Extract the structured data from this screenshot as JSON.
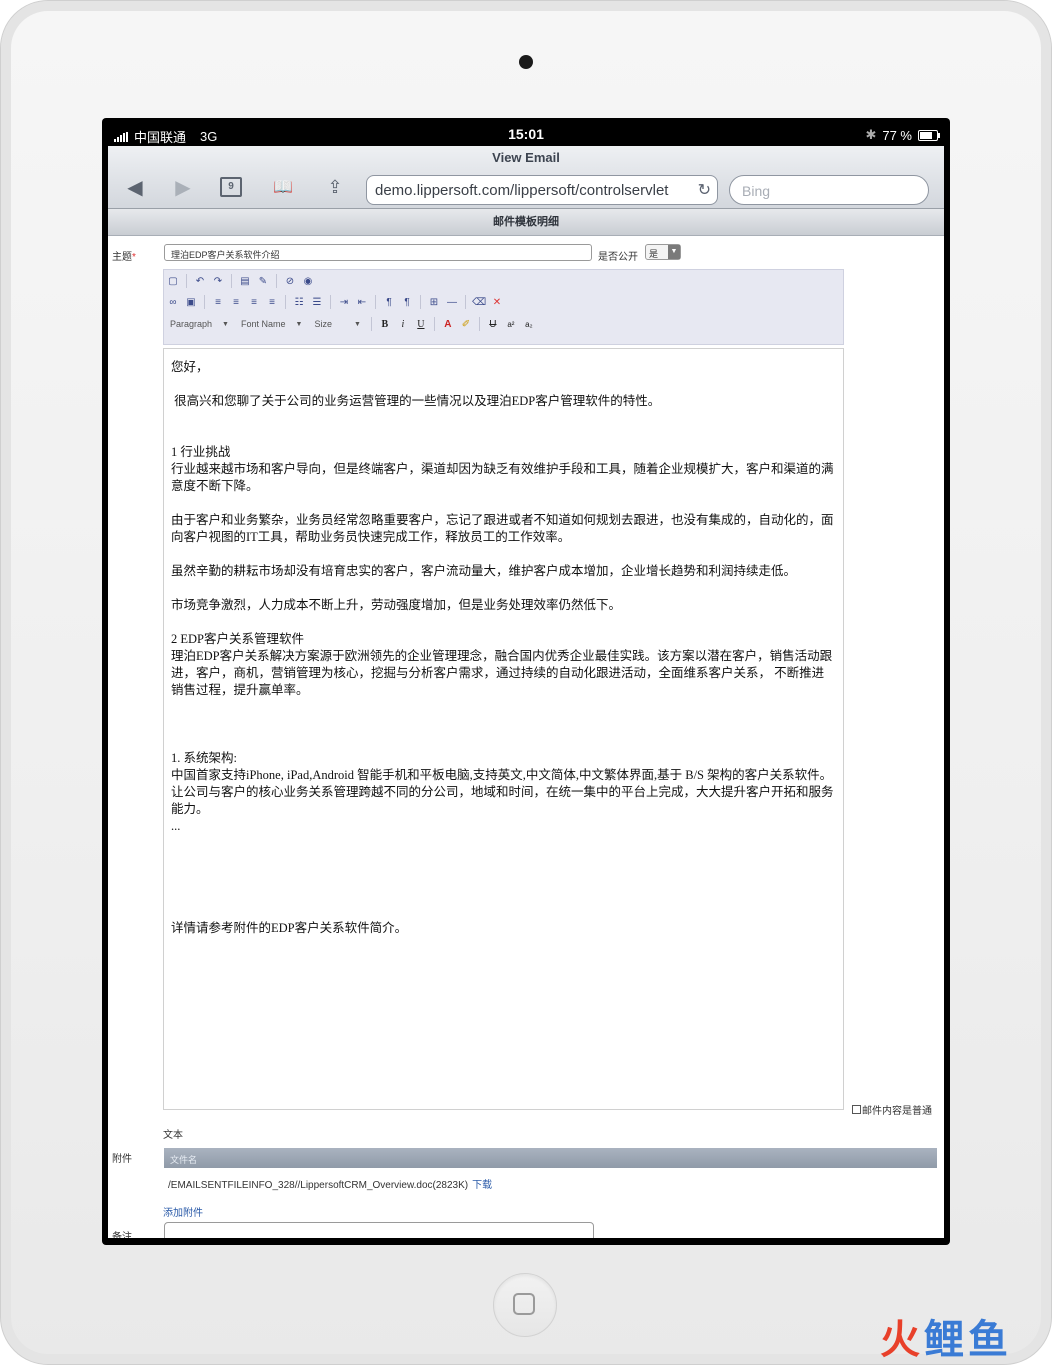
{
  "status": {
    "carrier": "中国联通",
    "network": "3G",
    "time": "15:01",
    "battery_pct": "77 %",
    "battery_level": 0.77
  },
  "browser": {
    "title": "View Email",
    "tabs_count": "9",
    "url": "demo.lippersoft.com/lippersoft/controlservlet",
    "search_placeholder": "Bing"
  },
  "page": {
    "title": "邮件模板明细",
    "subject_label": "主题",
    "required_mark": "*",
    "subject_value": "理泊EDP客户关系软件介绍",
    "public_label": "是否公开",
    "public_value": "是",
    "toolbar": {
      "paragraph": "Paragraph",
      "font_name": "Font Name",
      "size": "Size"
    },
    "body": [
      "您好，",
      "",
      " 很高兴和您聊了关于公司的业务运营管理的一些情况以及理泊EDP客户管理软件的特性。",
      "",
      "",
      "1 行业挑战",
      "行业越来越市场和客户导向，但是终端客户，渠道却因为缺乏有效维护手段和工具，随着企业规模扩大，客户和渠道的满意度不断下降。",
      "",
      "由于客户和业务繁杂，业务员经常忽略重要客户，忘记了跟进或者不知道如何规划去跟进，也没有集成的，自动化的，面向客户视图的IT工具，帮助业务员快速完成工作，释放员工的工作效率。",
      "",
      "虽然辛勤的耕耘市场却没有培育忠实的客户，客户流动量大，维护客户成本增加，企业增长趋势和利润持续走低。",
      "",
      "市场竞争激烈，人力成本不断上升，劳动强度增加，但是业务处理效率仍然低下。",
      "",
      "2 EDP客户关系管理软件",
      "理泊EDP客户关系解决方案源于欧洲领先的企业管理理念，融合国内优秀企业最佳实践。该方案以潜在客户，销售活动跟进，客户，商机，营销管理为核心，挖掘与分析客户需求，通过持续的自动化跟进活动，全面维系客户关系， 不断推进销售过程，提升赢单率。",
      "",
      "",
      "",
      "1. 系统架构:",
      "中国首家支持iPhone, iPad,Android 智能手机和平板电脑,支持英文,中文简体,中文繁体界面,基于 B/S 架构的客户关系软件。让公司与客户的核心业务关系管理跨越不同的分公司，地域和时间，在统一集中的平台上完成，大大提升客户开拓和服务能力。",
      "...",
      "",
      "",
      "",
      "",
      "",
      "详情请参考附件的EDP客户关系软件简介。"
    ],
    "plain_text_label": "邮件内容是普通",
    "plain_text_label2": "文本",
    "attachment_label": "附件",
    "attachment_col": "文件名",
    "attachment_file": "/EMAILSENTFILEINFO_328//LippersoftCRM_Overview.doc(2823K)",
    "download": "下载",
    "add_attachment": "添加附件",
    "remark_label": "备注"
  },
  "watermark": {
    "chars": [
      "火",
      "鲤",
      "鱼"
    ],
    "colors": [
      "#e8402a",
      "#3a7bd5",
      "#3a7bd5"
    ]
  }
}
